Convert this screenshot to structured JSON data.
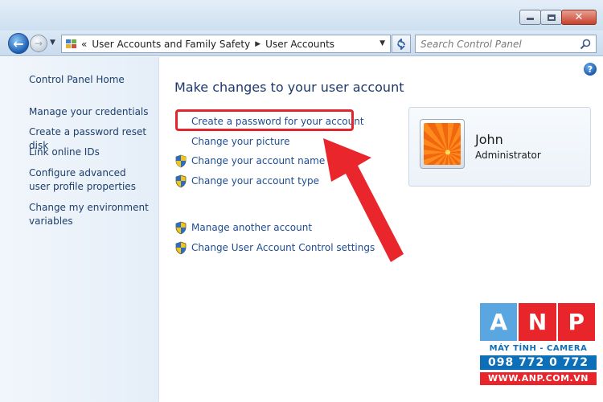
{
  "window": {
    "buttons": {
      "minimize_icon": "minimize-icon",
      "maximize_icon": "maximize-icon",
      "close_label": "✕"
    }
  },
  "navigation": {
    "breadcrumb_prefix": "«",
    "breadcrumb": [
      "User Accounts and Family Safety",
      "User Accounts"
    ],
    "search_placeholder": "Search Control Panel"
  },
  "left_pane": {
    "items": [
      "Control Panel Home",
      "Manage your credentials",
      "Create a password reset disk",
      "Link online IDs",
      "Configure advanced user profile properties",
      "Change my environment variables"
    ]
  },
  "main": {
    "heading": "Make changes to your user account",
    "tasks": [
      {
        "label": "Create a password for your account",
        "shield": false
      },
      {
        "label": "Change your picture",
        "shield": false
      },
      {
        "label": "Change your account name",
        "shield": true
      },
      {
        "label": "Change your account type",
        "shield": true
      },
      {
        "label": "Manage another account",
        "shield": true
      },
      {
        "label": "Change User Account Control settings",
        "shield": true
      }
    ],
    "help_label": "?"
  },
  "user": {
    "name": "John",
    "role": "Administrator"
  },
  "watermark": {
    "letters": [
      "A",
      "N",
      "P"
    ],
    "tile_colors": [
      "#5aa6e0",
      "#e8252b",
      "#e8252b"
    ],
    "tagline": "MÁY TÍNH - CAMERA",
    "phone": "098 772 0 772",
    "website": "WWW.ANP.COM.VN"
  },
  "colors": {
    "highlight_box": "#e3262d",
    "arrow": "#e8262b",
    "link": "#1e4d92",
    "heading": "#1d3a6b"
  }
}
